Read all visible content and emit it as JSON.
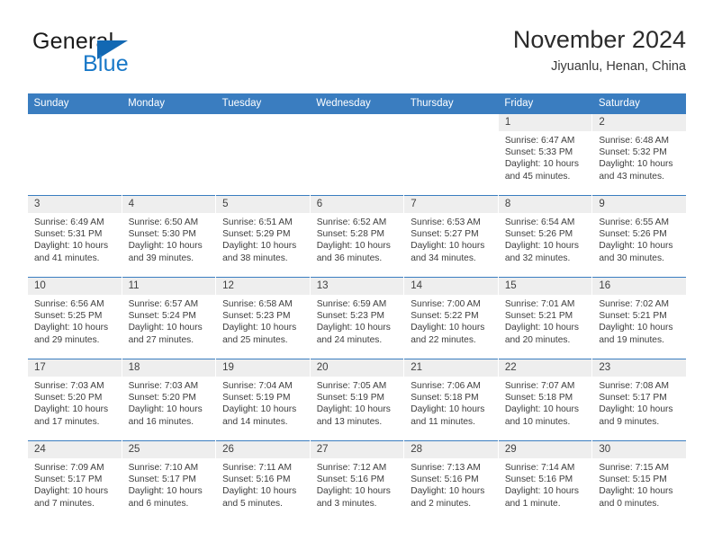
{
  "brand": {
    "name_top": "General",
    "name_bottom": "Blue",
    "triangle_color": "#1268b3",
    "blue_color": "#1878c8"
  },
  "header": {
    "title": "November 2024",
    "subtitle": "Jiyuanlu, Henan, China"
  },
  "theme": {
    "header_bg": "#3a7dc0",
    "daynum_bg": "#eeeeee",
    "cell_bg": "#ffffff",
    "text": "#3d3d3d"
  },
  "weekdays": [
    "Sunday",
    "Monday",
    "Tuesday",
    "Wednesday",
    "Thursday",
    "Friday",
    "Saturday"
  ],
  "weeks": [
    [
      {
        "day": "",
        "sunrise": "",
        "sunset": "",
        "daylight": "",
        "empty": true
      },
      {
        "day": "",
        "sunrise": "",
        "sunset": "",
        "daylight": "",
        "empty": true
      },
      {
        "day": "",
        "sunrise": "",
        "sunset": "",
        "daylight": "",
        "empty": true
      },
      {
        "day": "",
        "sunrise": "",
        "sunset": "",
        "daylight": "",
        "empty": true
      },
      {
        "day": "",
        "sunrise": "",
        "sunset": "",
        "daylight": "",
        "empty": true
      },
      {
        "day": "1",
        "sunrise": "Sunrise: 6:47 AM",
        "sunset": "Sunset: 5:33 PM",
        "daylight": "Daylight: 10 hours and 45 minutes."
      },
      {
        "day": "2",
        "sunrise": "Sunrise: 6:48 AM",
        "sunset": "Sunset: 5:32 PM",
        "daylight": "Daylight: 10 hours and 43 minutes."
      }
    ],
    [
      {
        "day": "3",
        "sunrise": "Sunrise: 6:49 AM",
        "sunset": "Sunset: 5:31 PM",
        "daylight": "Daylight: 10 hours and 41 minutes."
      },
      {
        "day": "4",
        "sunrise": "Sunrise: 6:50 AM",
        "sunset": "Sunset: 5:30 PM",
        "daylight": "Daylight: 10 hours and 39 minutes."
      },
      {
        "day": "5",
        "sunrise": "Sunrise: 6:51 AM",
        "sunset": "Sunset: 5:29 PM",
        "daylight": "Daylight: 10 hours and 38 minutes."
      },
      {
        "day": "6",
        "sunrise": "Sunrise: 6:52 AM",
        "sunset": "Sunset: 5:28 PM",
        "daylight": "Daylight: 10 hours and 36 minutes."
      },
      {
        "day": "7",
        "sunrise": "Sunrise: 6:53 AM",
        "sunset": "Sunset: 5:27 PM",
        "daylight": "Daylight: 10 hours and 34 minutes."
      },
      {
        "day": "8",
        "sunrise": "Sunrise: 6:54 AM",
        "sunset": "Sunset: 5:26 PM",
        "daylight": "Daylight: 10 hours and 32 minutes."
      },
      {
        "day": "9",
        "sunrise": "Sunrise: 6:55 AM",
        "sunset": "Sunset: 5:26 PM",
        "daylight": "Daylight: 10 hours and 30 minutes."
      }
    ],
    [
      {
        "day": "10",
        "sunrise": "Sunrise: 6:56 AM",
        "sunset": "Sunset: 5:25 PM",
        "daylight": "Daylight: 10 hours and 29 minutes."
      },
      {
        "day": "11",
        "sunrise": "Sunrise: 6:57 AM",
        "sunset": "Sunset: 5:24 PM",
        "daylight": "Daylight: 10 hours and 27 minutes."
      },
      {
        "day": "12",
        "sunrise": "Sunrise: 6:58 AM",
        "sunset": "Sunset: 5:23 PM",
        "daylight": "Daylight: 10 hours and 25 minutes."
      },
      {
        "day": "13",
        "sunrise": "Sunrise: 6:59 AM",
        "sunset": "Sunset: 5:23 PM",
        "daylight": "Daylight: 10 hours and 24 minutes."
      },
      {
        "day": "14",
        "sunrise": "Sunrise: 7:00 AM",
        "sunset": "Sunset: 5:22 PM",
        "daylight": "Daylight: 10 hours and 22 minutes."
      },
      {
        "day": "15",
        "sunrise": "Sunrise: 7:01 AM",
        "sunset": "Sunset: 5:21 PM",
        "daylight": "Daylight: 10 hours and 20 minutes."
      },
      {
        "day": "16",
        "sunrise": "Sunrise: 7:02 AM",
        "sunset": "Sunset: 5:21 PM",
        "daylight": "Daylight: 10 hours and 19 minutes."
      }
    ],
    [
      {
        "day": "17",
        "sunrise": "Sunrise: 7:03 AM",
        "sunset": "Sunset: 5:20 PM",
        "daylight": "Daylight: 10 hours and 17 minutes."
      },
      {
        "day": "18",
        "sunrise": "Sunrise: 7:03 AM",
        "sunset": "Sunset: 5:20 PM",
        "daylight": "Daylight: 10 hours and 16 minutes."
      },
      {
        "day": "19",
        "sunrise": "Sunrise: 7:04 AM",
        "sunset": "Sunset: 5:19 PM",
        "daylight": "Daylight: 10 hours and 14 minutes."
      },
      {
        "day": "20",
        "sunrise": "Sunrise: 7:05 AM",
        "sunset": "Sunset: 5:19 PM",
        "daylight": "Daylight: 10 hours and 13 minutes."
      },
      {
        "day": "21",
        "sunrise": "Sunrise: 7:06 AM",
        "sunset": "Sunset: 5:18 PM",
        "daylight": "Daylight: 10 hours and 11 minutes."
      },
      {
        "day": "22",
        "sunrise": "Sunrise: 7:07 AM",
        "sunset": "Sunset: 5:18 PM",
        "daylight": "Daylight: 10 hours and 10 minutes."
      },
      {
        "day": "23",
        "sunrise": "Sunrise: 7:08 AM",
        "sunset": "Sunset: 5:17 PM",
        "daylight": "Daylight: 10 hours and 9 minutes."
      }
    ],
    [
      {
        "day": "24",
        "sunrise": "Sunrise: 7:09 AM",
        "sunset": "Sunset: 5:17 PM",
        "daylight": "Daylight: 10 hours and 7 minutes."
      },
      {
        "day": "25",
        "sunrise": "Sunrise: 7:10 AM",
        "sunset": "Sunset: 5:17 PM",
        "daylight": "Daylight: 10 hours and 6 minutes."
      },
      {
        "day": "26",
        "sunrise": "Sunrise: 7:11 AM",
        "sunset": "Sunset: 5:16 PM",
        "daylight": "Daylight: 10 hours and 5 minutes."
      },
      {
        "day": "27",
        "sunrise": "Sunrise: 7:12 AM",
        "sunset": "Sunset: 5:16 PM",
        "daylight": "Daylight: 10 hours and 3 minutes."
      },
      {
        "day": "28",
        "sunrise": "Sunrise: 7:13 AM",
        "sunset": "Sunset: 5:16 PM",
        "daylight": "Daylight: 10 hours and 2 minutes."
      },
      {
        "day": "29",
        "sunrise": "Sunrise: 7:14 AM",
        "sunset": "Sunset: 5:16 PM",
        "daylight": "Daylight: 10 hours and 1 minute."
      },
      {
        "day": "30",
        "sunrise": "Sunrise: 7:15 AM",
        "sunset": "Sunset: 5:15 PM",
        "daylight": "Daylight: 10 hours and 0 minutes."
      }
    ]
  ]
}
